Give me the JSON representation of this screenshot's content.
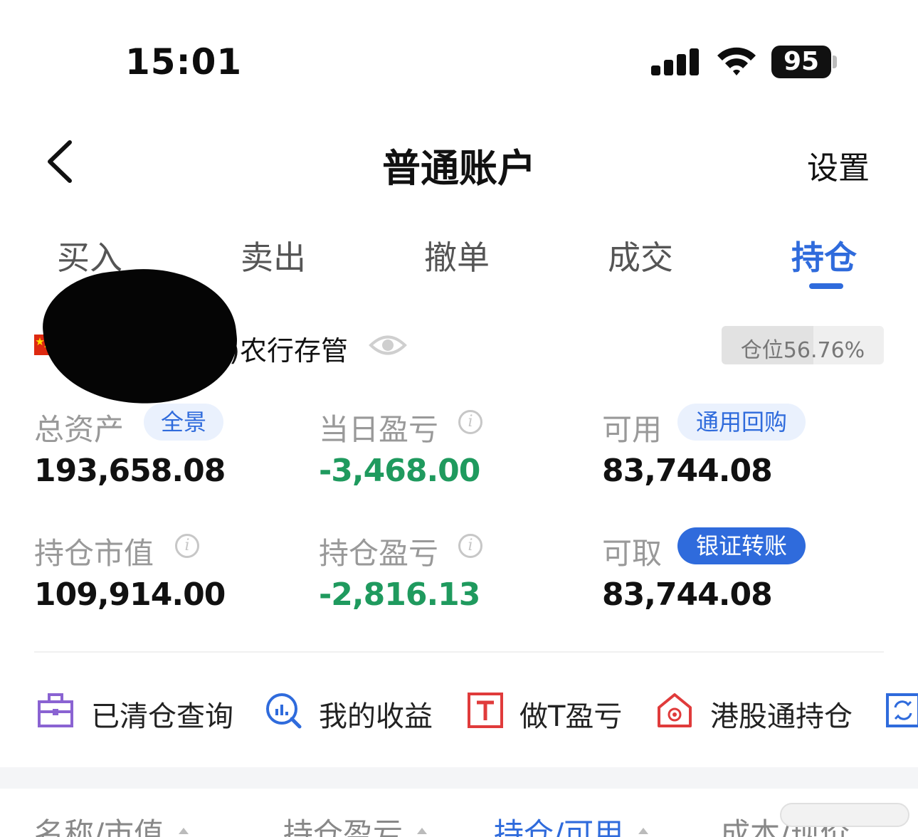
{
  "status_bar": {
    "time": "15:01",
    "battery": "95"
  },
  "header": {
    "title": "普通账户",
    "settings": "设置"
  },
  "tabs": [
    {
      "label": "买入",
      "active": false
    },
    {
      "label": "卖出",
      "active": false
    },
    {
      "label": "撤单",
      "active": false
    },
    {
      "label": "成交",
      "active": false
    },
    {
      "label": "持仓",
      "active": true
    }
  ],
  "account": {
    "name_visible": "8)农行存管",
    "position_label": "仓位56.76%",
    "position_ratio": 0.5676
  },
  "metrics": {
    "total_assets": {
      "label": "总资产",
      "chip": "全景",
      "value": "193,658.08"
    },
    "daily_pnl": {
      "label": "当日盈亏",
      "value": "-3,468.00"
    },
    "available": {
      "label": "可用",
      "chip": "通用回购",
      "value": "83,744.08"
    },
    "market_value": {
      "label": "持仓市值",
      "value": "109,914.00"
    },
    "position_pnl": {
      "label": "持仓盈亏",
      "value": "-2,816.13"
    },
    "withdrawable": {
      "label": "可取",
      "chip": "银证转账",
      "value": "83,744.08"
    }
  },
  "shortcuts": [
    {
      "label": "已清仓查询",
      "icon": "briefcase-icon"
    },
    {
      "label": "我的收益",
      "icon": "chart-search-icon"
    },
    {
      "label": "做T盈亏",
      "icon": "t-box-icon"
    },
    {
      "label": "港股通持仓",
      "icon": "hk-house-icon"
    },
    {
      "label": "",
      "icon": "transfer-icon"
    }
  ],
  "table_header": {
    "col1": "名称/市值",
    "col2": "持仓盈亏",
    "col3": "持仓/可用",
    "col4": "成本/现价"
  },
  "colors": {
    "accent": "#2f6bdc",
    "loss": "#1f9a5e",
    "flag": "#de2910"
  }
}
